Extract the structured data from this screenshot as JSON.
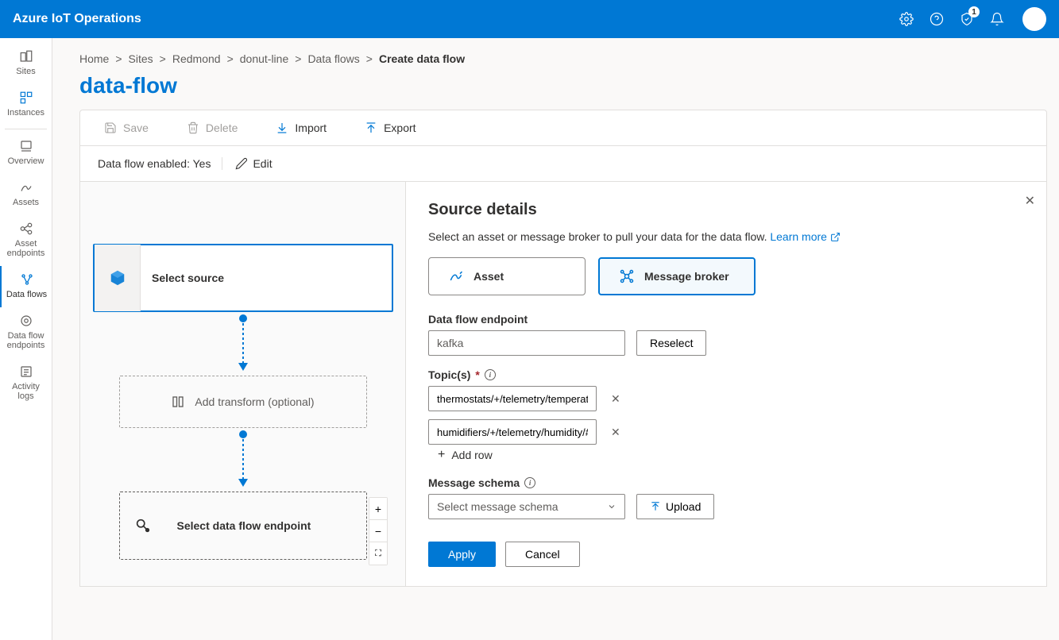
{
  "topbar": {
    "title": "Azure IoT Operations",
    "notification_badge": "1"
  },
  "sidebar": {
    "items": [
      {
        "label": "Sites"
      },
      {
        "label": "Instances"
      },
      {
        "label": "Overview"
      },
      {
        "label": "Assets"
      },
      {
        "label": "Asset endpoints"
      },
      {
        "label": "Data flows"
      },
      {
        "label": "Data flow endpoints"
      },
      {
        "label": "Activity logs"
      }
    ]
  },
  "breadcrumbs": {
    "items": [
      "Home",
      "Sites",
      "Redmond",
      "donut-line",
      "Data flows"
    ],
    "current": "Create data flow"
  },
  "page": {
    "title": "data-flow"
  },
  "toolbar": {
    "save": "Save",
    "delete": "Delete",
    "import": "Import",
    "export": "Export"
  },
  "status": {
    "label": "Data flow enabled: Yes",
    "edit": "Edit"
  },
  "flow": {
    "source_label": "Select source",
    "transform_label": "Add transform (optional)",
    "endpoint_label": "Select data flow endpoint"
  },
  "details": {
    "title": "Source details",
    "description": "Select an asset or message broker to pull your data for the data flow. ",
    "learn_more": "Learn more",
    "tabs": {
      "asset": "Asset",
      "broker": "Message broker"
    },
    "endpoint_label": "Data flow endpoint",
    "endpoint_value": "kafka",
    "reselect": "Reselect",
    "topics_label": "Topic(s)",
    "topics": [
      "thermostats/+/telemetry/temperature/#",
      "humidifiers/+/telemetry/humidity/#"
    ],
    "add_row": "Add row",
    "schema_label": "Message schema",
    "schema_placeholder": "Select message schema",
    "upload": "Upload",
    "apply": "Apply",
    "cancel": "Cancel"
  }
}
